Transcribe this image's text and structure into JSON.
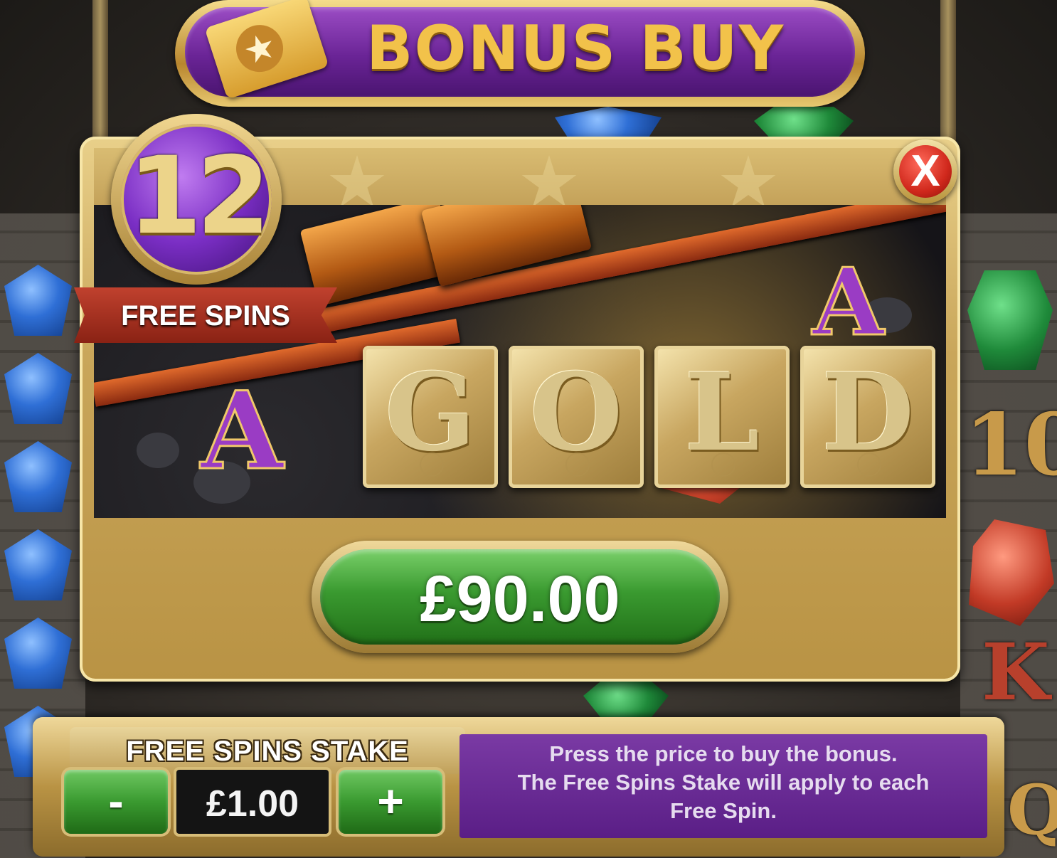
{
  "header": {
    "title": "BONUS BUY",
    "icon": "ticket-star-icon"
  },
  "badge": {
    "count": "12",
    "label": "FREE SPINS"
  },
  "art_tiles": [
    "G",
    "O",
    "L",
    "D"
  ],
  "close": {
    "label": "X"
  },
  "price": {
    "label": "£90.00"
  },
  "stake": {
    "title": "FREE SPINS STAKE",
    "decrease_label": "-",
    "value": "£1.00",
    "increase_label": "+"
  },
  "info": {
    "lines": [
      "Press the price to buy the bonus.",
      "The Free Spins Stake will apply to each",
      "Free Spin."
    ]
  },
  "background_letters": [
    "A",
    "A",
    "10",
    "K",
    "Q"
  ],
  "colors": {
    "purple": "#6a2496",
    "gold": "#c9a65a",
    "green_button": "#3a9a30",
    "close_red": "#d0281c",
    "ribbon_red": "#a62c1c"
  }
}
